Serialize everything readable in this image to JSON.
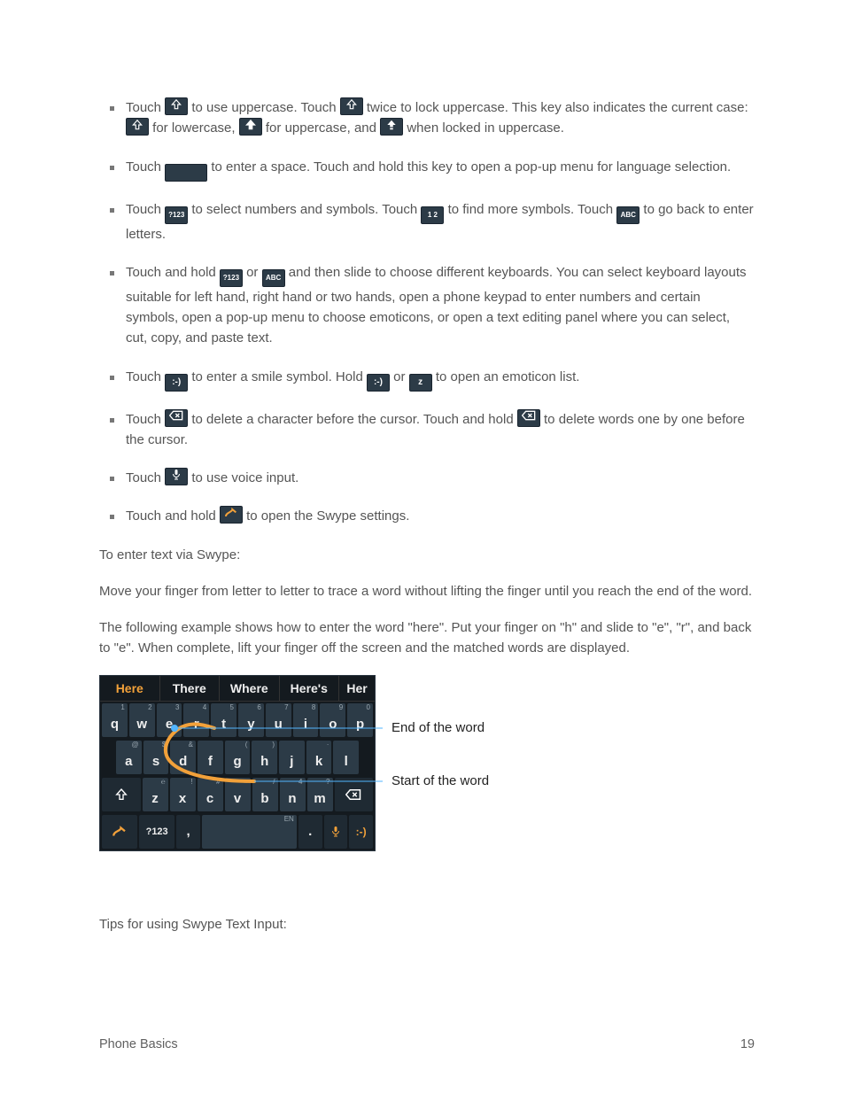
{
  "bullets": {
    "b1": {
      "t0": "Touch",
      "t1": "to use uppercase. Touch",
      "t2": "twice to lock uppercase. This key also indicates the current case:",
      "t3": "for lowercase,",
      "t4": "for uppercase, and",
      "t5": "when locked in uppercase."
    },
    "b2": {
      "t0": "Touch",
      "t1": "to enter a space. Touch and hold this key to open a pop-up menu for language selection."
    },
    "b3": {
      "t0": "Touch",
      "t1": "to select numbers and symbols. Touch",
      "t2": "to find more symbols. Touch",
      "t3": "to go back to enter letters."
    },
    "b4": {
      "t0": "Touch and hold",
      "t1": "or",
      "t2": "and then slide to choose different keyboards. You can select keyboard layouts suitable for left hand, right hand or two hands, open a phone keypad to enter numbers and certain symbols, open a pop-up menu to choose emoticons, or open a text editing panel where you can select, cut, copy, and paste text."
    },
    "b5": {
      "t0": "Touch",
      "t1": "to enter a smile symbol. Hold",
      "t2": "or",
      "t3": "to open an emoticon list."
    },
    "b6": {
      "t0": "Touch",
      "t1": "to delete a character before the cursor. Touch and hold",
      "t2": "to delete words one by one before the cursor."
    },
    "b7": {
      "t0": "Touch",
      "t1": "to use voice input."
    },
    "b8": {
      "t0": "Touch and hold",
      "t1": "to open the Swype settings."
    }
  },
  "paragraphs": {
    "p1": "To enter text via Swype:",
    "p2": "Move your finger from letter to letter to trace a word without lifting the finger until you reach the end of the word.",
    "p3": "The following example shows how to enter the word \"here\". Put your finger on \"h\" and slide to \"e\", \"r\", and back to \"e\". When complete, lift your finger off the screen and the matched words are displayed.",
    "tips": "Tips for using Swype Text Input:"
  },
  "keys": {
    "q123": "?123",
    "abc": "ABC",
    "smile": ":-)",
    "z": "z",
    "page12": "1  2"
  },
  "keyboard": {
    "suggest": [
      "Here",
      "There",
      "Where",
      "Here's",
      "Her"
    ],
    "row1_hints": [
      "1",
      "2",
      "3",
      "4",
      "5",
      "6",
      "7",
      "8",
      "9",
      "0"
    ],
    "row1": [
      "q",
      "w",
      "e",
      "r",
      "t",
      "y",
      "u",
      "i",
      "o",
      "p"
    ],
    "row2_hints": [
      "@",
      "$",
      "&",
      "",
      "(",
      ")",
      "",
      "·",
      ""
    ],
    "row2": [
      "a",
      "s",
      "d",
      "f",
      "g",
      "h",
      "j",
      "k",
      "l"
    ],
    "row3_hints": [
      "",
      "℮",
      "!",
      "#",
      "=",
      "/",
      "4",
      "?"
    ],
    "row3": [
      "",
      "z",
      "x",
      "c",
      "v",
      "b",
      "n",
      "m",
      ""
    ],
    "row4": {
      "q123": "?123",
      "comma": ",",
      "space": "",
      "space_hint": "EN",
      "period": ".",
      "mic": "",
      "smile": ":-)"
    }
  },
  "annotations": {
    "end": "End of the word",
    "start": "Start of the word"
  },
  "footer": {
    "left": "Phone Basics",
    "right": "19"
  }
}
